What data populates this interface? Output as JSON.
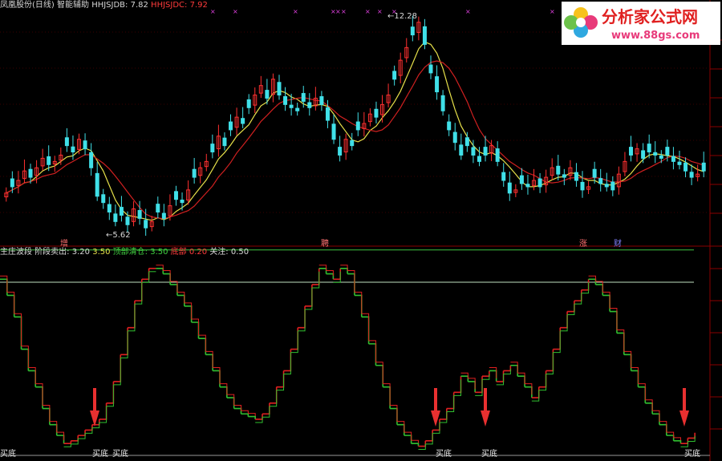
{
  "header_top": {
    "stock": "凤凰股份(日线)",
    "indicator": "智能辅助",
    "hh_db_label": "HHJSJDB:",
    "hh_db_value": "7.82",
    "hh_dc_label": "HHJSJDC:",
    "hh_dc_value": "7.92"
  },
  "header_bottom": {
    "name": "主庄波段",
    "stage_sell_label": "阶段卖出:",
    "stage_sell_value": "3.20",
    "v2": "3.50",
    "top_clear_label": "顶部清仓:",
    "top_clear_value": "3.50",
    "bottom_label": "底部",
    "bottom_value": "0.20",
    "focus_label": "关注:",
    "focus_value": "0.50"
  },
  "logo": {
    "text": "分析家公式网",
    "url": "www.88gs.com"
  },
  "colors": {
    "up": "#ff3030",
    "down": "#40e0e8",
    "ma_short": "#e6e04a",
    "ma_long": "#d02020",
    "wave_up": "#e02020",
    "wave_down": "#30c030",
    "grid": "#6a0000",
    "line_top": "#40c040"
  },
  "chart_data": [
    {
      "type": "candlestick",
      "annotations": [
        {
          "text": "5.62",
          "kind": "low"
        },
        {
          "text": "12.28",
          "kind": "high"
        }
      ],
      "event_markers": [
        "增",
        "聘",
        "涨",
        "财"
      ],
      "closes": [
        6.8,
        7.0,
        7.2,
        7.5,
        7.3,
        7.6,
        7.9,
        7.7,
        7.8,
        8.0,
        8.3,
        8.1,
        8.5,
        8.2,
        7.6,
        6.7,
        6.5,
        6.2,
        5.9,
        6.1,
        5.8,
        6.3,
        6.0,
        5.7,
        5.9,
        6.2,
        6.0,
        6.4,
        6.6,
        6.5,
        6.9,
        7.3,
        7.6,
        7.8,
        8.1,
        8.6,
        8.3,
        8.8,
        9.2,
        9.0,
        9.5,
        9.9,
        10.2,
        9.8,
        10.4,
        9.9,
        9.6,
        9.5,
        9.4,
        9.7,
        9.5,
        9.8,
        9.6,
        9.1,
        8.5,
        8.0,
        8.5,
        8.3,
        8.8,
        9.0,
        9.3,
        9.2,
        9.6,
        9.9,
        10.4,
        11.0,
        11.4,
        11.8,
        12.2,
        11.5,
        10.6,
        10.0,
        9.4,
        8.8,
        8.4,
        8.0,
        8.3,
        8.0,
        7.8,
        8.0,
        8.3,
        7.8,
        7.2,
        6.8,
        6.9,
        7.1,
        7.0,
        7.2,
        7.0,
        7.3,
        7.6,
        7.4,
        7.3,
        7.6,
        7.2,
        6.9,
        7.0,
        7.3,
        7.1,
        7.0,
        6.9,
        7.4,
        7.8,
        8.0,
        8.2,
        7.9,
        8.1,
        8.0,
        7.9,
        8.0,
        7.8,
        7.7,
        7.5,
        7.3,
        7.4,
        7.5
      ],
      "ma_short_name": "",
      "ma_long_name": ""
    },
    {
      "type": "step-line",
      "levels": {
        "top_line": 3.5,
        "stage_line": 3.2,
        "bottom_line": 0.2
      },
      "values": [
        3.3,
        3.0,
        2.6,
        2.0,
        1.6,
        1.3,
        0.9,
        0.6,
        0.4,
        0.25,
        0.3,
        0.4,
        0.5,
        0.6,
        0.7,
        1.0,
        1.4,
        1.9,
        2.4,
        2.9,
        3.3,
        3.5,
        3.5,
        3.4,
        3.2,
        3.0,
        2.8,
        2.5,
        2.2,
        1.9,
        1.6,
        1.3,
        1.1,
        0.9,
        0.8,
        0.75,
        0.7,
        0.8,
        1.0,
        1.3,
        1.6,
        2.0,
        2.4,
        2.8,
        3.2,
        3.5,
        3.4,
        3.3,
        3.5,
        3.4,
        3.0,
        2.6,
        2.1,
        1.7,
        1.3,
        0.9,
        0.6,
        0.4,
        0.25,
        0.2,
        0.3,
        0.5,
        0.7,
        0.9,
        1.2,
        1.5,
        1.4,
        1.2,
        1.5,
        1.6,
        1.4,
        1.6,
        1.7,
        1.5,
        1.3,
        1.1,
        1.3,
        1.6,
        2.0,
        2.4,
        2.7,
        2.9,
        3.1,
        3.3,
        3.2,
        3.0,
        2.7,
        2.3,
        1.9,
        1.6,
        1.3,
        1.0,
        0.8,
        0.6,
        0.4,
        0.3,
        0.25,
        0.35,
        0.45
      ],
      "buy_labels": [
        "买底",
        "买底",
        "买底",
        "买底",
        "买底",
        "买底"
      ]
    }
  ]
}
